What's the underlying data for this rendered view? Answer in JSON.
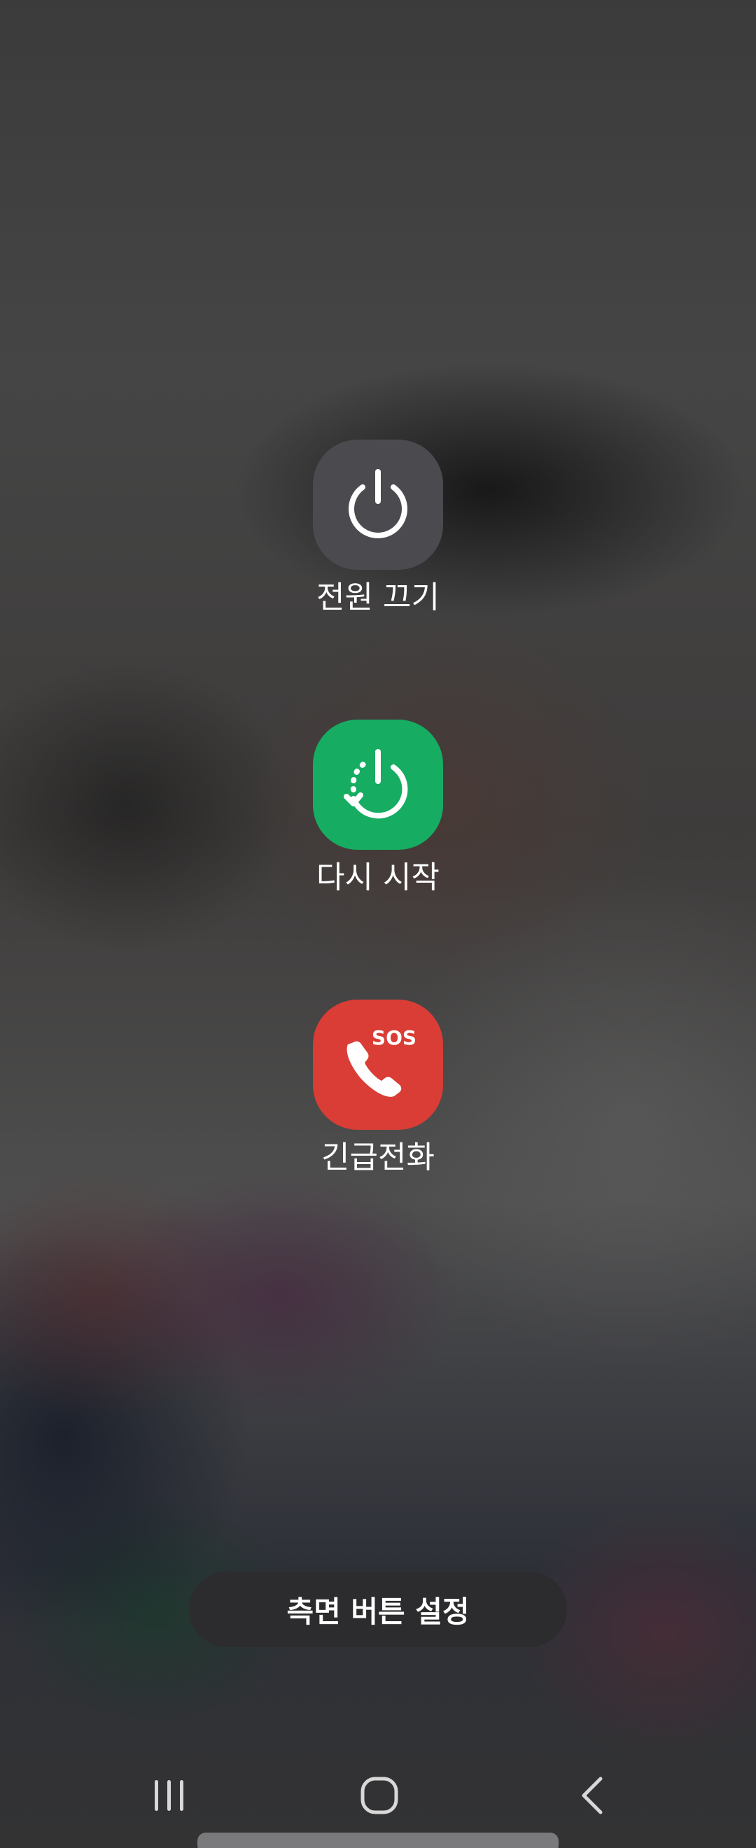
{
  "power_menu": {
    "items": [
      {
        "label": "전원 끄기",
        "icon": "power-icon",
        "color": "#4b4b4f"
      },
      {
        "label": "다시 시작",
        "icon": "restart-icon",
        "color": "#16ad62"
      },
      {
        "label": "긴급전화",
        "icon": "sos-phone-icon",
        "color": "#d93d36",
        "icon_text": "SOS"
      }
    ]
  },
  "side_button_settings": {
    "label": "측면 버튼 설정"
  },
  "navbar": {
    "recents": "recent-apps-icon",
    "home": "home-icon",
    "back": "back-icon"
  }
}
